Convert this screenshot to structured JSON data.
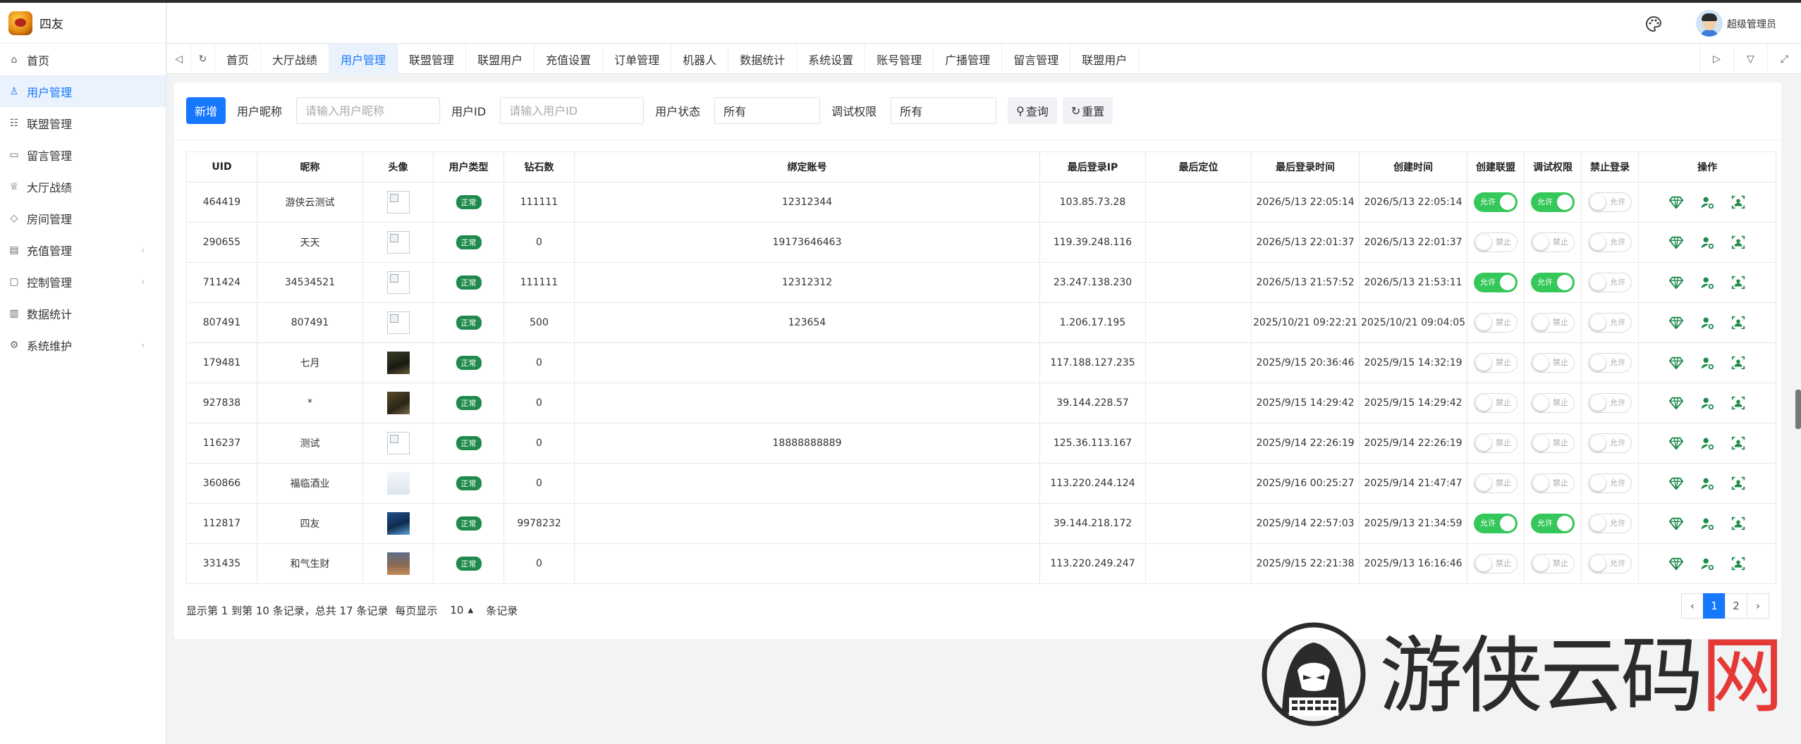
{
  "brand": {
    "name": "四友"
  },
  "sidebar": {
    "items": [
      {
        "label": "首页",
        "icon": "home-icon",
        "active": false,
        "arrow": false
      },
      {
        "label": "用户管理",
        "icon": "user-icon",
        "active": true,
        "arrow": false
      },
      {
        "label": "联盟管理",
        "icon": "group-icon",
        "active": false,
        "arrow": false
      },
      {
        "label": "留言管理",
        "icon": "message-icon",
        "active": false,
        "arrow": false
      },
      {
        "label": "大厅战绩",
        "icon": "trophy-icon",
        "active": false,
        "arrow": false
      },
      {
        "label": "房间管理",
        "icon": "diamond-icon",
        "active": false,
        "arrow": false
      },
      {
        "label": "充值管理",
        "icon": "wallet-icon",
        "active": false,
        "arrow": true
      },
      {
        "label": "控制管理",
        "icon": "monitor-icon",
        "active": false,
        "arrow": true
      },
      {
        "label": "数据统计",
        "icon": "bar-chart-icon",
        "active": false,
        "arrow": false
      },
      {
        "label": "系统维护",
        "icon": "gear-icon",
        "active": false,
        "arrow": true
      }
    ]
  },
  "header": {
    "admin_name": "超级管理员"
  },
  "tabs": [
    "首页",
    "大厅战绩",
    "用户管理",
    "联盟管理",
    "联盟用户",
    "充值设置",
    "订单管理",
    "机器人",
    "数据统计",
    "系统设置",
    "账号管理",
    "广播管理",
    "留言管理",
    "联盟用户"
  ],
  "active_tab_index": 2,
  "filters": {
    "add_label": "新增",
    "nickname_label": "用户昵称",
    "nickname_placeholder": "请输入用户昵称",
    "uid_label": "用户ID",
    "uid_placeholder": "请输入用户ID",
    "status_label": "用户状态",
    "status_value": "所有",
    "debug_label": "调试权限",
    "debug_value": "所有",
    "query_label": "查询",
    "reset_label": "重置"
  },
  "table": {
    "headers": [
      "UID",
      "昵称",
      "头像",
      "用户类型",
      "钻石数",
      "绑定账号",
      "最后登录IP",
      "最后定位",
      "最后登录时间",
      "创建时间",
      "创建联盟",
      "调试权限",
      "禁止登录",
      "操作"
    ],
    "switch_on_label": "允许",
    "switch_off_label": "禁止",
    "switch_ban_label": "允许",
    "rows": [
      {
        "uid": "464419",
        "nickname": "游侠云测试",
        "avatar": "broken",
        "type": "正常",
        "diamonds": "111111",
        "account": "12312344",
        "ip": "103.85.73.28",
        "location": "",
        "last_login": "2026/5/13 22:05:14",
        "created": "2026/5/13 22:05:14",
        "alliance": true,
        "debug": true,
        "ban": false
      },
      {
        "uid": "290655",
        "nickname": "天天",
        "avatar": "broken",
        "type": "正常",
        "diamonds": "0",
        "account": "19173646463",
        "ip": "119.39.248.116",
        "location": "",
        "last_login": "2026/5/13 22:01:37",
        "created": "2026/5/13 22:01:37",
        "alliance": false,
        "debug": false,
        "ban": false
      },
      {
        "uid": "711424",
        "nickname": "34534521",
        "avatar": "broken",
        "type": "正常",
        "diamonds": "111111",
        "account": "12312312",
        "ip": "23.247.138.230",
        "location": "",
        "last_login": "2026/5/13 21:57:52",
        "created": "2026/5/13 21:53:11",
        "alliance": true,
        "debug": true,
        "ban": false
      },
      {
        "uid": "807491",
        "nickname": "807491",
        "avatar": "broken",
        "type": "正常",
        "diamonds": "500",
        "account": "123654",
        "ip": "1.206.17.195",
        "location": "",
        "last_login": "2025/10/21 09:22:21",
        "created": "2025/10/21 09:04:05",
        "alliance": false,
        "debug": false,
        "ban": false
      },
      {
        "uid": "179481",
        "nickname": "七月",
        "avatar": "dark",
        "type": "正常",
        "diamonds": "0",
        "account": "",
        "ip": "117.188.127.235",
        "location": "",
        "last_login": "2025/9/15 20:36:46",
        "created": "2025/9/15 14:32:19",
        "alliance": false,
        "debug": false,
        "ban": false
      },
      {
        "uid": "927838",
        "nickname": "*",
        "avatar": "olive",
        "type": "正常",
        "diamonds": "0",
        "account": "",
        "ip": "39.144.228.57",
        "location": "",
        "last_login": "2025/9/15 14:29:42",
        "created": "2025/9/15 14:29:42",
        "alliance": false,
        "debug": false,
        "ban": false
      },
      {
        "uid": "116237",
        "nickname": "测试",
        "avatar": "broken",
        "type": "正常",
        "diamonds": "0",
        "account": "18888888889",
        "ip": "125.36.113.167",
        "location": "",
        "last_login": "2025/9/14 22:26:19",
        "created": "2025/9/14 22:26:19",
        "alliance": false,
        "debug": false,
        "ban": false
      },
      {
        "uid": "360866",
        "nickname": "福临酒业",
        "avatar": "light",
        "type": "正常",
        "diamonds": "0",
        "account": "",
        "ip": "113.220.244.124",
        "location": "",
        "last_login": "2025/9/16 00:25:27",
        "created": "2025/9/14 21:47:47",
        "alliance": false,
        "debug": false,
        "ban": false
      },
      {
        "uid": "112817",
        "nickname": "四友",
        "avatar": "blue",
        "type": "正常",
        "diamonds": "9978232",
        "account": "",
        "ip": "39.144.218.172",
        "location": "",
        "last_login": "2025/9/14 22:57:03",
        "created": "2025/9/13 21:34:59",
        "alliance": true,
        "debug": true,
        "ban": false
      },
      {
        "uid": "331435",
        "nickname": "和气生财",
        "avatar": "warm",
        "type": "正常",
        "diamonds": "0",
        "account": "",
        "ip": "113.220.249.247",
        "location": "",
        "last_login": "2025/9/15 22:21:38",
        "created": "2025/9/13 16:16:46",
        "alliance": false,
        "debug": false,
        "ban": false
      }
    ],
    "actions": [
      "diamond-icon",
      "user-gear-icon",
      "user-id-icon"
    ]
  },
  "pagination": {
    "info_prefix": "显示第 1 到第 10 条记录，总共 17 条记录",
    "per_page_label": "每页显示",
    "per_page": "10",
    "suffix": "条记录",
    "pages": [
      "1",
      "2"
    ],
    "prev": "‹",
    "next": "›",
    "current_page": "1"
  },
  "watermark": {
    "text_main": "游侠云码",
    "text_red": "网"
  },
  "colors": {
    "accent": "#1677ff",
    "switch_on": "#34c759",
    "badge": "#1f8a4c"
  }
}
